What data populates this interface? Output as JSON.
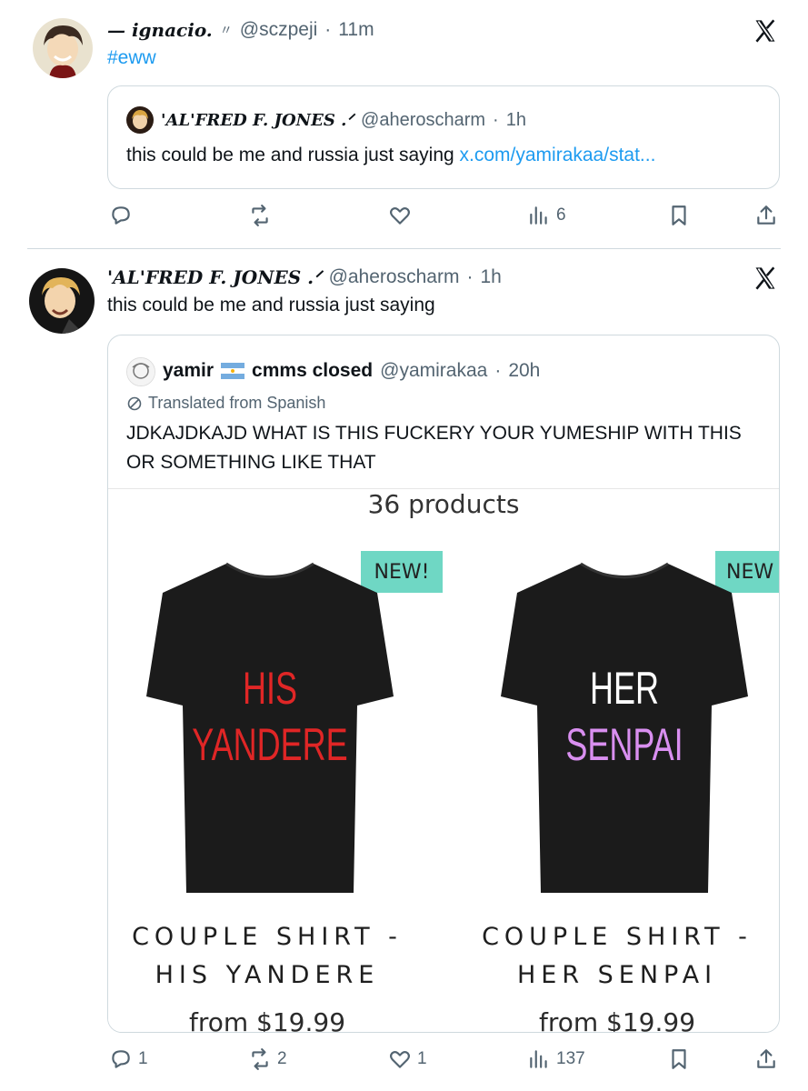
{
  "tweet1": {
    "display_name": "— ignacio.",
    "name_mark": "〃",
    "handle": "@sczpeji",
    "time": "11m",
    "text": "#eww",
    "quote": {
      "display_name": "'AL'FRED F. JONES .ᐟ",
      "handle": "@aheroscharm",
      "time": "1h",
      "text": "this could be me and russia just saying ",
      "link": "x.com/yamirakaa/stat..."
    },
    "actions": {
      "views": "6"
    }
  },
  "tweet2": {
    "display_name": "'AL'FRED F. JONES .ᐟ",
    "handle": "@aheroscharm",
    "time": "1h",
    "text": "this could be me and russia just saying",
    "quote": {
      "display_name": "yamir",
      "flag": "argentina-flag",
      "display_name_rest": "cmms closed",
      "handle": "@yamirakaa",
      "time": "20h",
      "translated_label": "Translated from Spanish",
      "text": "JDKAJDKAJD WHAT IS THIS FUCKERY YOUR YUMESHIP WITH THIS OR SOMETHING LIKE THAT",
      "media": {
        "header": "36 products",
        "products": [
          {
            "badge": "NEW!",
            "shirt_line1": "HIS",
            "shirt_line2": "YANDERE",
            "title_line1": "COUPLE SHIRT -",
            "title_line2": "HIS YANDERE",
            "price": "from $19.99"
          },
          {
            "badge": "NEW",
            "shirt_line1": "HER",
            "shirt_line2": "SENPAI",
            "title_line1": "COUPLE SHIRT -",
            "title_line2": "HER SENPAI",
            "price": "from $19.99"
          }
        ]
      }
    },
    "actions": {
      "replies": "1",
      "reposts": "2",
      "likes": "1",
      "views": "137"
    }
  },
  "colors": {
    "link": "#1d9bf0",
    "muted": "#536471",
    "badge": "#6fd7c4",
    "his_text": "#e02626",
    "her_text_top": "#ffffff",
    "her_text_bottom": "#d98ff0"
  }
}
